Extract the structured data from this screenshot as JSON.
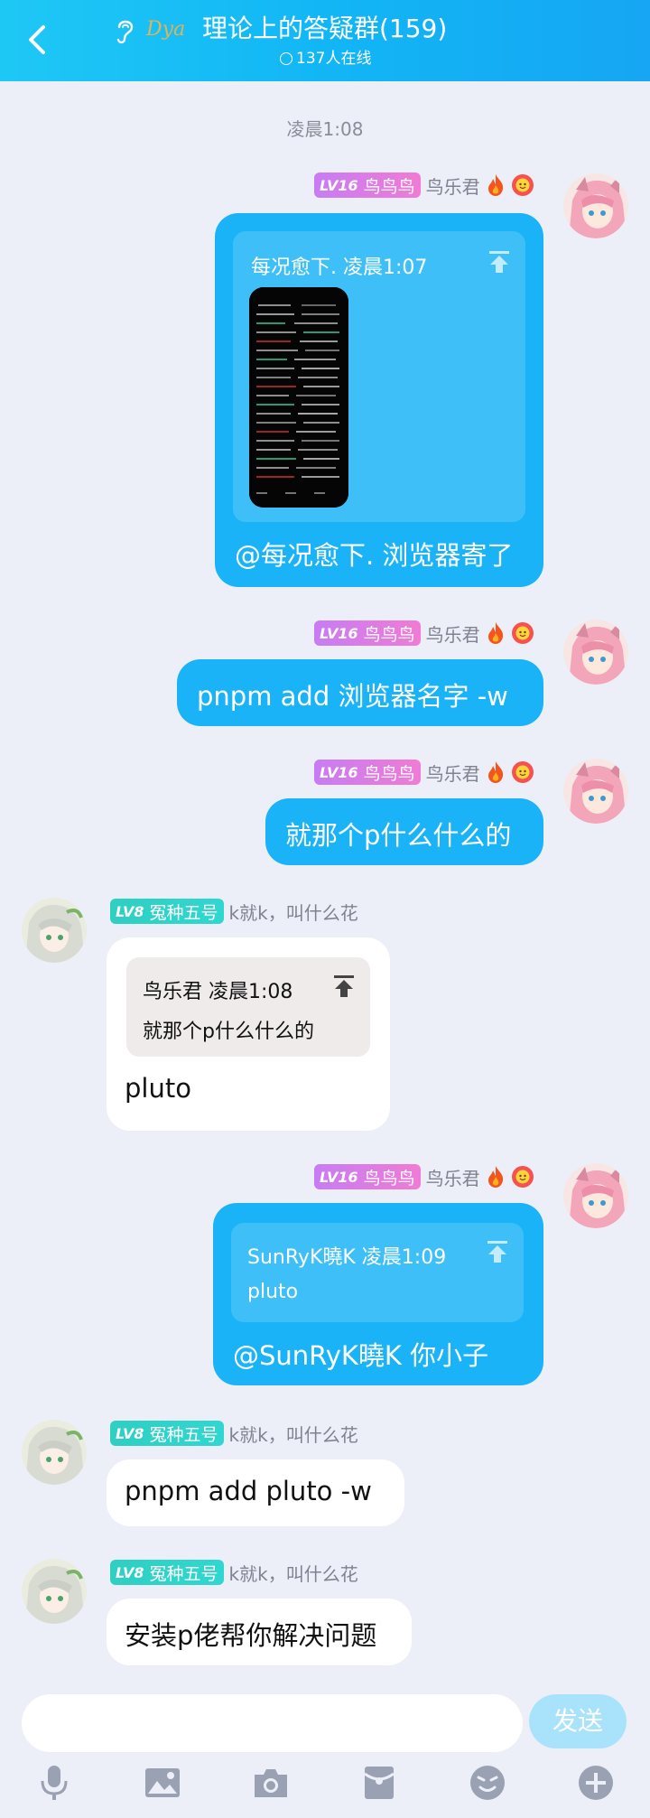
{
  "header": {
    "title": "理论上的答疑群(159)",
    "online": "137人在线",
    "badge_text": "Dya"
  },
  "timestamp": "凌晨1:08",
  "messages": [
    {
      "dir": "out",
      "level": "LV16",
      "title": "鸟鸟鸟",
      "nick": "鸟乐君",
      "quote": {
        "head": "每况愈下. 凌晨1:07",
        "has_image": true
      },
      "text": "@每况愈下. 浏览器寄了"
    },
    {
      "dir": "out",
      "level": "LV16",
      "title": "鸟鸟鸟",
      "nick": "鸟乐君",
      "text": "pnpm add 浏览器名字 -w"
    },
    {
      "dir": "out",
      "level": "LV16",
      "title": "鸟鸟鸟",
      "nick": "鸟乐君",
      "text": "就那个p什么什么的"
    },
    {
      "dir": "in",
      "level": "LV8",
      "title": "冤种五号",
      "nick": "k就k，叫什么花",
      "quote": {
        "head": "鸟乐君 凌晨1:08",
        "text": "就那个p什么什么的"
      },
      "text": "pluto"
    },
    {
      "dir": "out",
      "level": "LV16",
      "title": "鸟鸟鸟",
      "nick": "鸟乐君",
      "quote": {
        "head": "SunRyK曉K 凌晨1:09",
        "text": "pluto"
      },
      "text": "@SunRyK曉K 你小子"
    },
    {
      "dir": "in",
      "level": "LV8",
      "title": "冤种五号",
      "nick": "k就k，叫什么花",
      "text": "pnpm add pluto -w"
    },
    {
      "dir": "in",
      "level": "LV8",
      "title": "冤种五号",
      "nick": "k就k，叫什么花",
      "text": "安装p佬帮你解决问题"
    }
  ],
  "composer": {
    "placeholder": "",
    "send_label": "发送"
  },
  "toolbar": [
    "microphone-icon",
    "image-icon",
    "camera-icon",
    "red-packet-icon",
    "emoji-icon",
    "plus-icon"
  ],
  "colors": {
    "header": "#12b6f5",
    "bubble_out": "#1ab3f7",
    "bubble_in": "#ffffff",
    "background": "#eceff7",
    "level_pink": "#d07cf0",
    "level_teal": "#2fcfc2"
  }
}
